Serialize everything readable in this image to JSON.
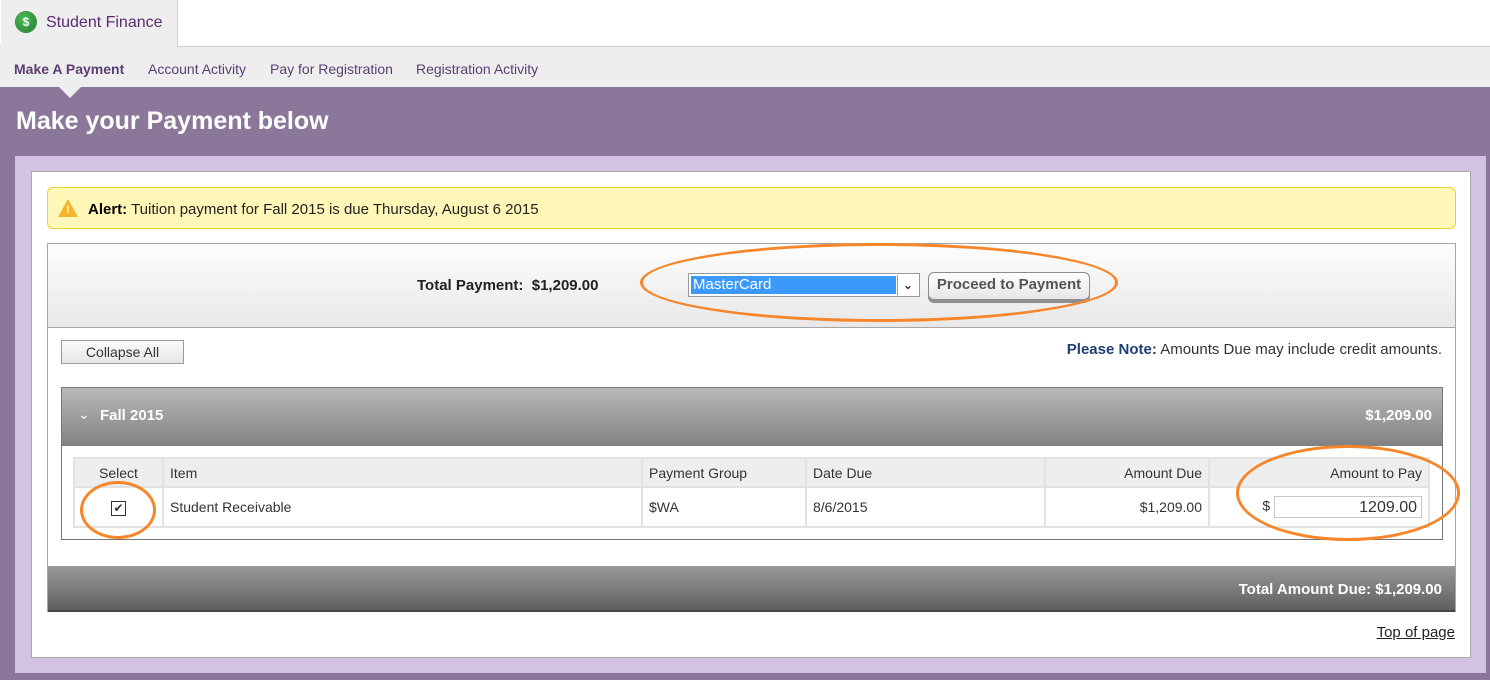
{
  "app": {
    "tab_label": "Student Finance",
    "tab_icon": "dollar-coin-icon"
  },
  "subnav": {
    "items": [
      {
        "label": "Make A Payment",
        "active": true
      },
      {
        "label": "Account Activity",
        "active": false
      },
      {
        "label": "Pay for Registration",
        "active": false
      },
      {
        "label": "Registration Activity",
        "active": false
      }
    ]
  },
  "page": {
    "title": "Make your Payment below"
  },
  "alert": {
    "icon": "warning-icon",
    "prefix": "Alert:",
    "message": "Tuition payment for Fall 2015 is due Thursday, August 6 2015"
  },
  "payment": {
    "total_label": "Total Payment:",
    "total_value": "$1,209.00",
    "method_selected": "MasterCard",
    "proceed_label": "Proceed to Payment",
    "collapse_label": "Collapse All",
    "note_prefix": "Please Note:",
    "note_text": "Amounts Due may include credit amounts."
  },
  "term": {
    "name": "Fall 2015",
    "amount": "$1,209.00",
    "columns": [
      "Select",
      "Item",
      "Payment Group",
      "Date Due",
      "Amount Due",
      "Amount to Pay"
    ],
    "rows": [
      {
        "selected": true,
        "item": "Student Receivable",
        "payment_group": "$WA",
        "date_due": "8/6/2015",
        "amount_due": "$1,209.00",
        "currency_symbol": "$",
        "amount_to_pay": "1209.00"
      }
    ]
  },
  "footer": {
    "total_due": "Total Amount Due: $1,209.00",
    "top_link": "Top of page"
  },
  "colors": {
    "header_purple": "#8a7799",
    "panel_lilac": "#d3c2e2",
    "alert_bg": "#fff7b7",
    "annotation_orange": "#f7862b",
    "select_highlight": "#3b99fc"
  }
}
